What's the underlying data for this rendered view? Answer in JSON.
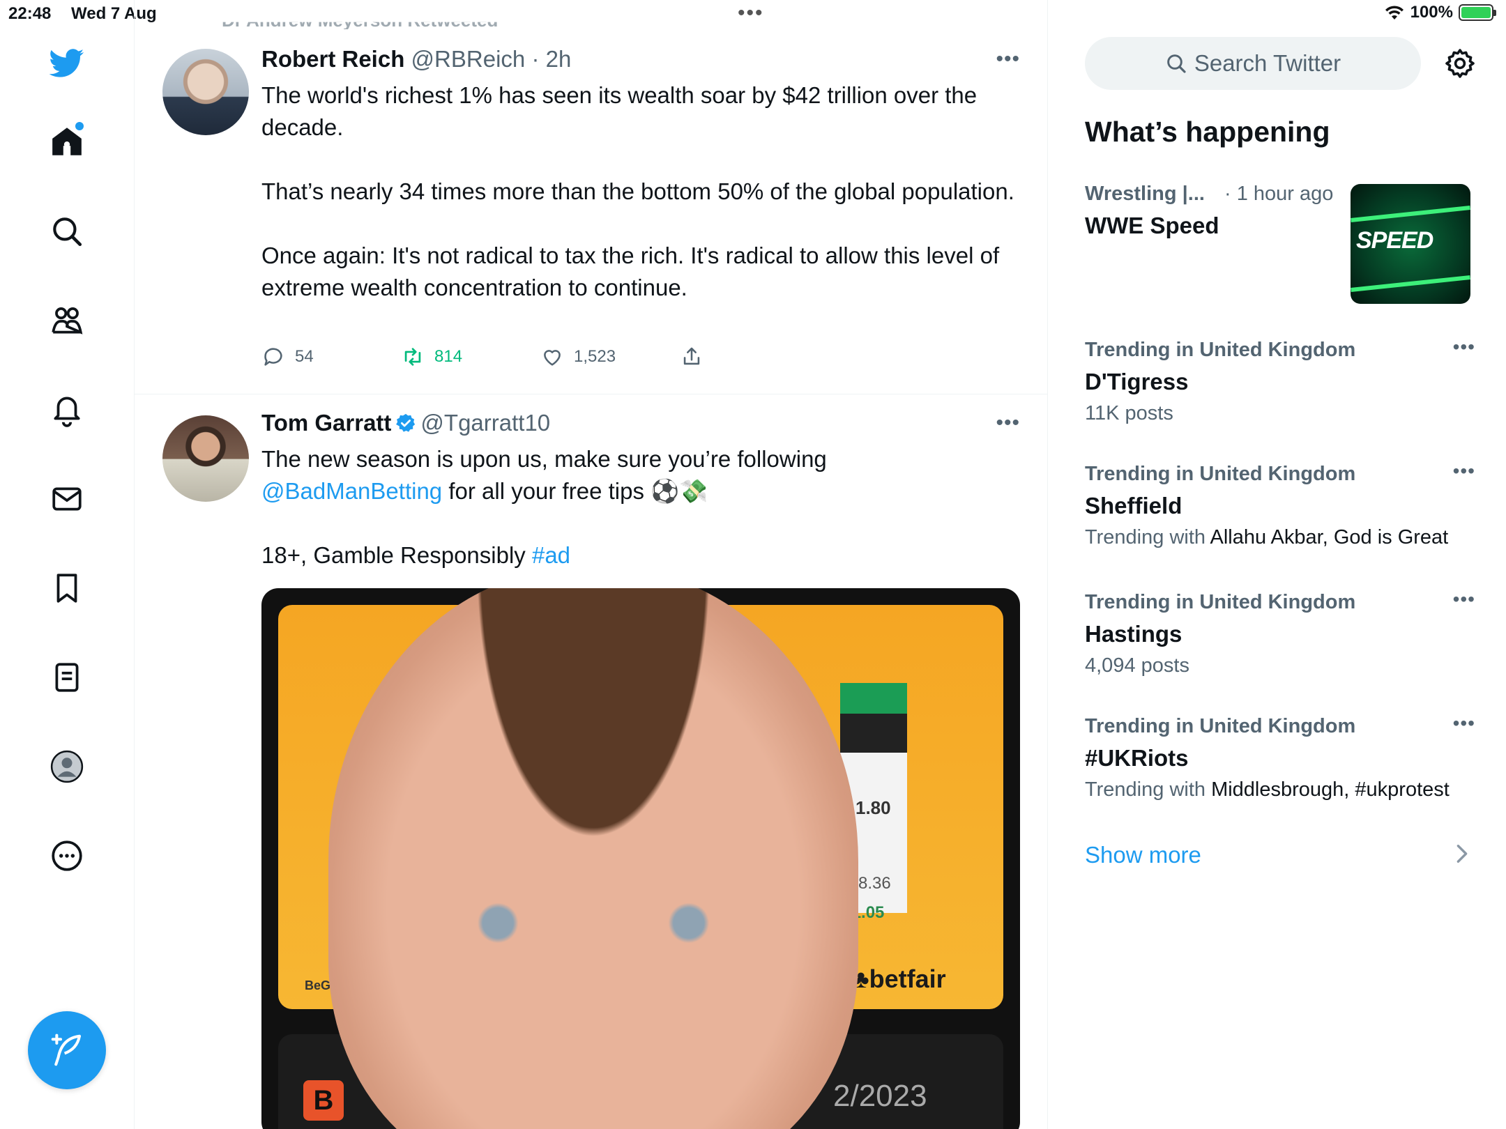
{
  "status_bar": {
    "time": "22:48",
    "date": "Wed 7 Aug",
    "battery": "100%"
  },
  "nav": {
    "items": [
      "twitter-logo",
      "home",
      "explore",
      "communities",
      "notifications",
      "messages",
      "bookmarks",
      "lists",
      "profile",
      "more"
    ],
    "compose_label": "compose"
  },
  "timeline": {
    "retweet_banner": "Dr Andrew Meyerson Retweeted",
    "tweets": [
      {
        "name": "Robert Reich",
        "handle": "@RBReich",
        "time": "· 2h",
        "paragraphs": [
          "The world's richest 1% has seen its wealth soar by $42 trillion over the decade.",
          "That’s nearly 34 times more than the bottom 50% of the global population.",
          "Once again: It's not radical to tax the rich. It's radical to allow this level of extreme wealth concentration to continue."
        ],
        "replies": "54",
        "retweets": "814",
        "likes": "1,523"
      },
      {
        "name": "Tom Garratt",
        "handle": "@Tgarratt10",
        "verified": true,
        "line1": "The new season is upon us, make sure you’re following",
        "mention": "@BadManBetting",
        "line2_rest": " for all your free tips ⚽💸",
        "line3_text": "18+, Gamble Responsibly ",
        "hashtag": "#ad",
        "media": {
          "odds": "1.80",
          "amount1": "£278.36",
          "amount2": "501.05",
          "brand": "♣betfair",
          "partial_text": "BeG",
          "b_logo": "B",
          "date_fragment": "2/2023"
        }
      }
    ]
  },
  "sidebar": {
    "search_placeholder": "Search Twitter",
    "section_title": "What’s happening",
    "trends": [
      {
        "meta": "Wrestling |...",
        "meta_time": "· 1 hour ago",
        "title": "WWE Speed",
        "image_label": "SPEED"
      },
      {
        "meta": "Trending in United Kingdom",
        "title": "D'Tigress",
        "sub": "11K posts"
      },
      {
        "meta": "Trending in United Kingdom",
        "title": "Sheffield",
        "sub_prefix": "Trending with",
        "sub_dark": "Allahu Akbar, God is Great"
      },
      {
        "meta": "Trending in United Kingdom",
        "title": "Hastings",
        "sub": "4,094 posts"
      },
      {
        "meta": "Trending in United Kingdom",
        "title": "#UKRiots",
        "sub_prefix": "Trending with",
        "sub_dark": "Middlesbrough, #ukprotest"
      }
    ],
    "show_more": "Show more"
  },
  "colors": {
    "accent": "#1d9bf0",
    "retweet_green": "#00ba7c",
    "muted": "#536471",
    "text": "#0f1419"
  }
}
